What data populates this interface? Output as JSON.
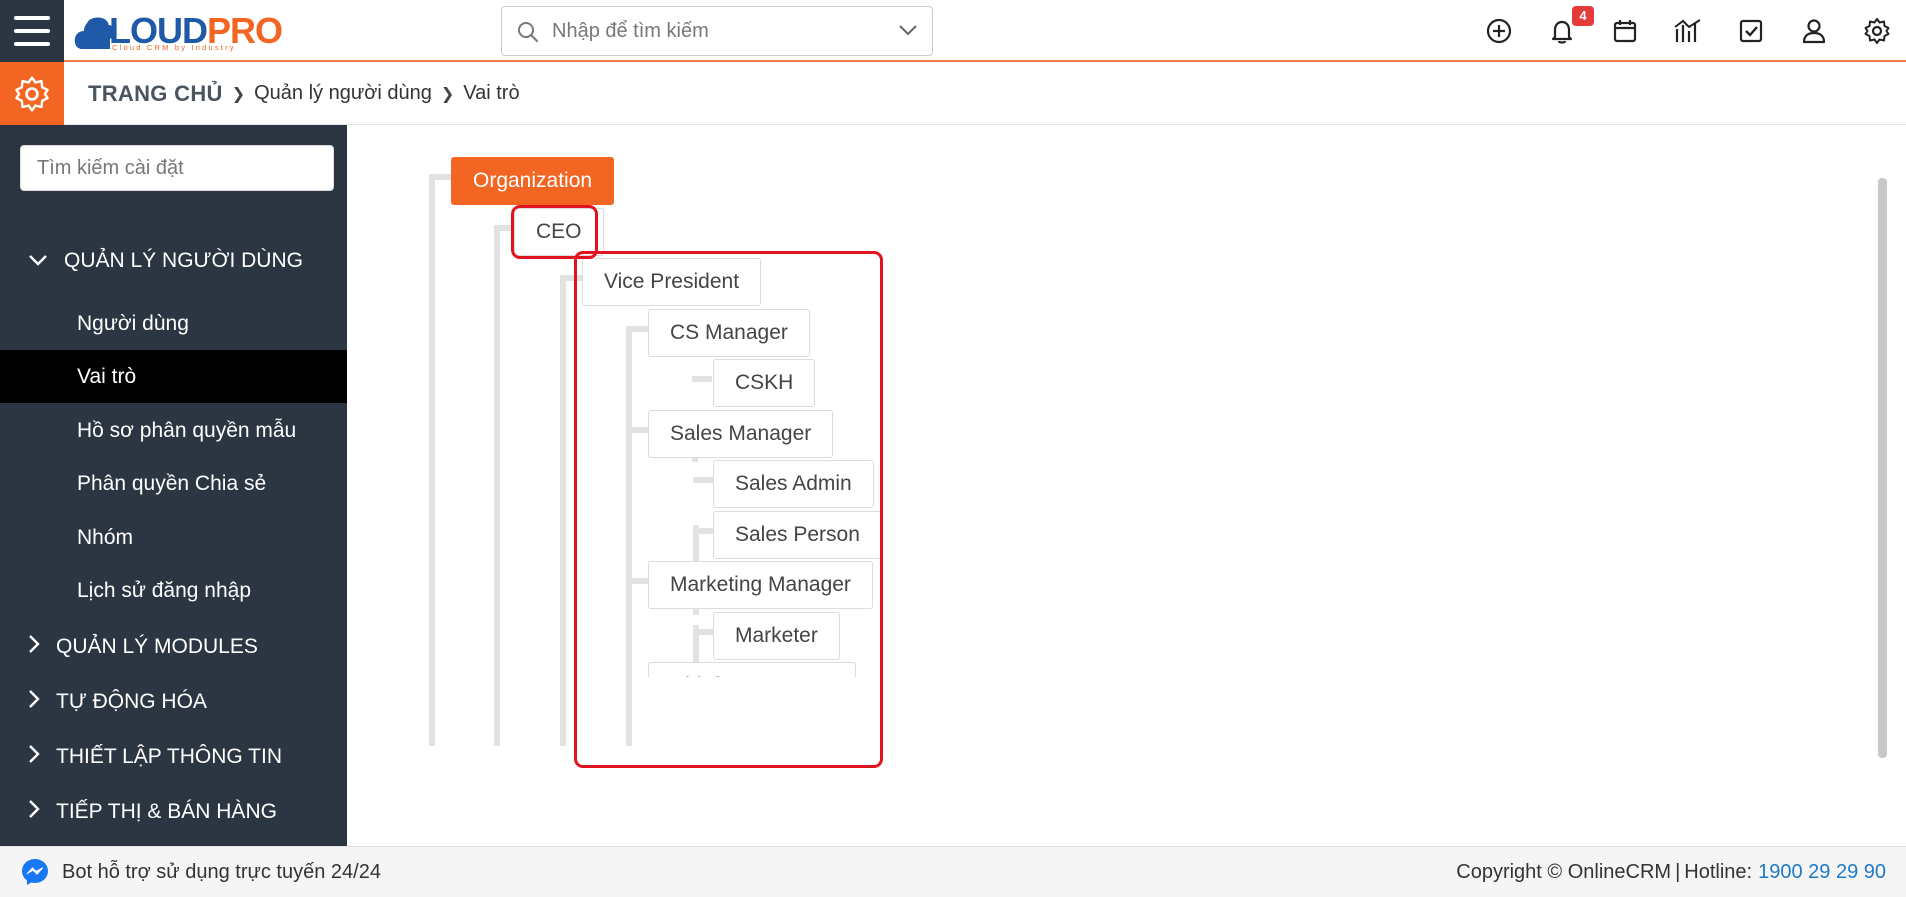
{
  "app": {
    "brand_part1": "CLOUD",
    "brand_part2": "PRO",
    "tagline": "Cloud CRM by Industry"
  },
  "header": {
    "search_placeholder": "Nhập để tìm kiếm",
    "notification_count": "4",
    "icons": [
      "plus-circle-icon",
      "bell-icon",
      "calendar-icon",
      "reports-chart-icon",
      "task-checkbox-icon",
      "user-icon",
      "gear-icon"
    ]
  },
  "breadcrumb": {
    "home": "TRANG CHỦ",
    "level1": "Quản lý người dùng",
    "current": "Vai trò"
  },
  "sidebar": {
    "search_placeholder": "Tìm kiếm cài đặt",
    "groups": [
      {
        "label": "QUẢN LÝ NGƯỜI DÙNG",
        "expanded": true
      },
      {
        "label": "QUẢN LÝ MODULES",
        "expanded": false
      },
      {
        "label": "TỰ ĐỘNG HÓA",
        "expanded": false
      },
      {
        "label": "THIẾT LẬP THÔNG TIN",
        "expanded": false
      },
      {
        "label": "TIẾP THỊ & BÁN HÀNG",
        "expanded": false
      }
    ],
    "items": [
      {
        "label": "Người dùng"
      },
      {
        "label": "Vai trò",
        "active": true
      },
      {
        "label": "Hồ sơ phân quyền mẫu"
      },
      {
        "label": "Phân quyền Chia sẻ"
      },
      {
        "label": "Nhóm"
      },
      {
        "label": "Lịch sử đăng nhập"
      }
    ]
  },
  "roles_tree": {
    "organization": "Organization",
    "ceo": "CEO",
    "vice_president": "Vice President",
    "cs_manager": "CS Manager",
    "cskh": "CSKH",
    "sales_manager": "Sales Manager",
    "sales_admin": "Sales Admin",
    "sales_person": "Sales Person",
    "marketing_manager": "Marketing Manager",
    "marketer": "Marketer",
    "partial_node": "Chief ..."
  },
  "footer": {
    "bot_text": "Bot hỗ trợ sử dụng trực tuyến 24/24",
    "copyright": "Copyright © OnlineCRM",
    "separator": "|",
    "hotline_label": "Hotline:",
    "hotline_number": "1900 29 29 90"
  },
  "colors": {
    "accent": "#f26522",
    "sidebar_bg": "#2b3642",
    "active_item_bg": "#000000",
    "highlight_border": "#e0141f",
    "brand_blue": "#1e5aa8",
    "link_blue": "#1e7ac8"
  }
}
